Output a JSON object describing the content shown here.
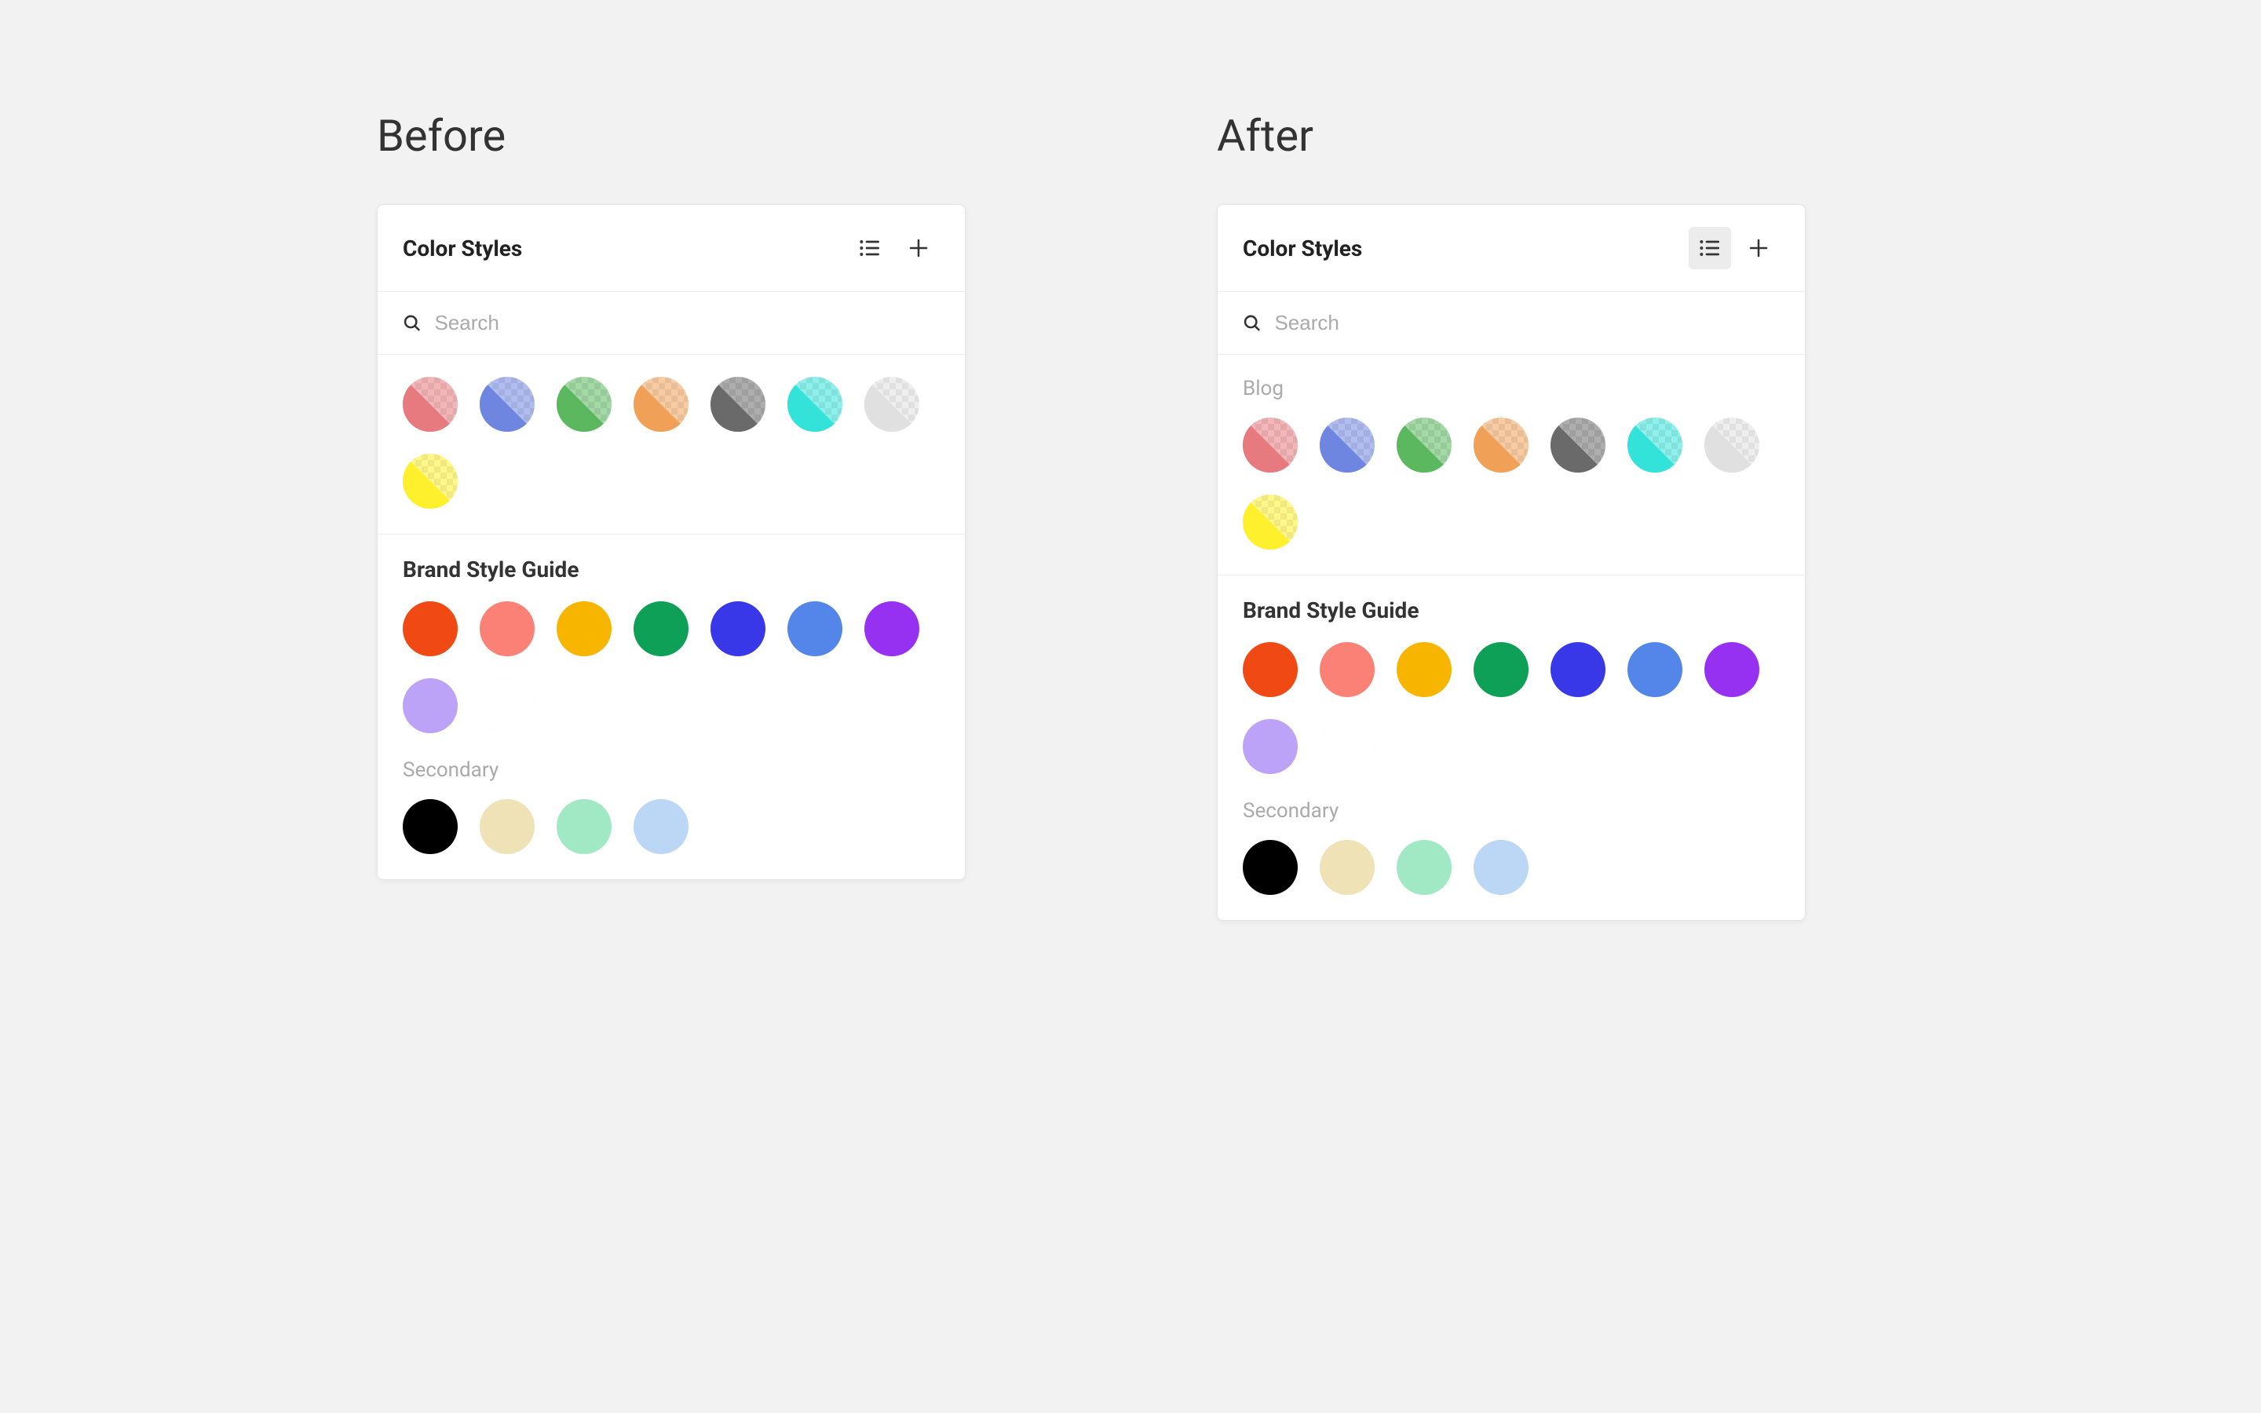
{
  "labels": {
    "before": "Before",
    "after": "After"
  },
  "panel": {
    "title": "Color Styles",
    "search_placeholder": "Search"
  },
  "before_panel": {
    "top_section": {
      "swatches": [
        {
          "color": "#e77a7e",
          "alpha": true
        },
        {
          "color": "#6f86e0",
          "alpha": true
        },
        {
          "color": "#5bb85f",
          "alpha": true
        },
        {
          "color": "#f0a157",
          "alpha": true
        },
        {
          "color": "#6a6a6a",
          "alpha": true
        },
        {
          "color": "#33e2d8",
          "alpha": true
        },
        {
          "color": "#e0e0e0",
          "alpha": true
        },
        {
          "color": "#fff02e",
          "alpha": true
        }
      ]
    },
    "brand_section": {
      "title": "Brand Style Guide",
      "swatches": [
        {
          "color": "#f04913"
        },
        {
          "color": "#fb8177"
        },
        {
          "color": "#f7b500"
        },
        {
          "color": "#0ea057"
        },
        {
          "color": "#3838e8"
        },
        {
          "color": "#5486ea"
        },
        {
          "color": "#9731f2"
        },
        {
          "color": "#bda3f7"
        },
        {
          "color": "#ffffff",
          "outlined": true
        }
      ],
      "secondary_label": "Secondary",
      "secondary_swatches": [
        {
          "color": "#000000"
        },
        {
          "color": "#eee2b6"
        },
        {
          "color": "#a1e8c4"
        },
        {
          "color": "#bcd6f5"
        }
      ]
    }
  },
  "after_panel": {
    "blog_section": {
      "label": "Blog",
      "swatches": [
        {
          "color": "#e77a7e",
          "alpha": true
        },
        {
          "color": "#6f86e0",
          "alpha": true
        },
        {
          "color": "#5bb85f",
          "alpha": true
        },
        {
          "color": "#f0a157",
          "alpha": true
        },
        {
          "color": "#6a6a6a",
          "alpha": true
        },
        {
          "color": "#33e2d8",
          "alpha": true
        },
        {
          "color": "#e0e0e0",
          "alpha": true
        },
        {
          "color": "#fff02e",
          "alpha": true
        }
      ]
    },
    "brand_section": {
      "title": "Brand Style Guide",
      "swatches": [
        {
          "color": "#f04913"
        },
        {
          "color": "#fb8177"
        },
        {
          "color": "#f7b500"
        },
        {
          "color": "#0ea057"
        },
        {
          "color": "#3838e8"
        },
        {
          "color": "#5486ea"
        },
        {
          "color": "#9731f2"
        },
        {
          "color": "#bda3f7"
        },
        {
          "color": "#ffffff",
          "outlined": true
        }
      ],
      "secondary_label": "Secondary",
      "secondary_swatches": [
        {
          "color": "#000000"
        },
        {
          "color": "#eee2b6"
        },
        {
          "color": "#a1e8c4"
        },
        {
          "color": "#bcd6f5"
        }
      ]
    }
  }
}
